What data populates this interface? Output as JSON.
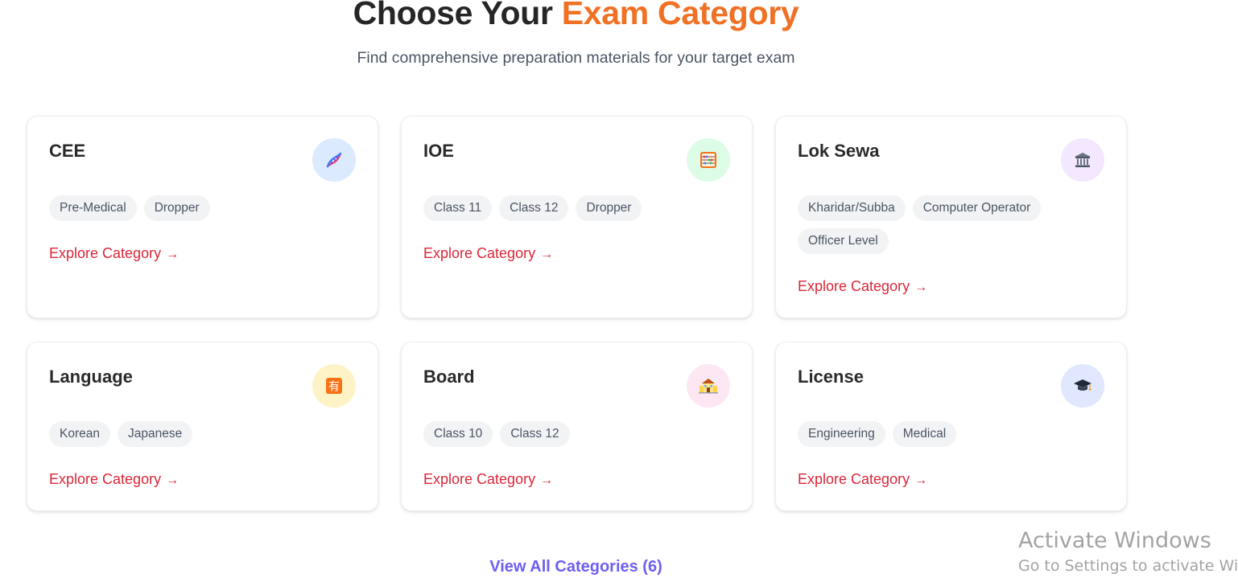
{
  "header": {
    "title_main": "Choose Your",
    "title_accent": "Exam Category",
    "subtitle": "Find comprehensive preparation materials for your target exam"
  },
  "colors": {
    "accent": "#f07124",
    "link": "#dc2638",
    "view_all": "#6d5ef0"
  },
  "categories": [
    {
      "title": "CEE",
      "icon": "dna-icon",
      "icon_bg": "#dbeafe",
      "tags": [
        "Pre-Medical",
        "Dropper"
      ],
      "cta": "Explore Category",
      "cta_arrow": "→"
    },
    {
      "title": "IOE",
      "icon": "abacus-icon",
      "icon_bg": "#dcfce7",
      "tags": [
        "Class 11",
        "Class 12",
        "Dropper"
      ],
      "cta": "Explore Category",
      "cta_arrow": "→"
    },
    {
      "title": "Lok Sewa",
      "icon": "government-building-icon",
      "icon_bg": "#f3e8ff",
      "tags": [
        "Kharidar/Subba",
        "Computer Operator",
        "Officer Level"
      ],
      "cta": "Explore Category",
      "cta_arrow": "→"
    },
    {
      "title": "Language",
      "icon": "japanese-character-icon",
      "icon_bg": "#fef3c7",
      "tags": [
        "Korean",
        "Japanese"
      ],
      "cta": "Explore Category",
      "cta_arrow": "→"
    },
    {
      "title": "Board",
      "icon": "school-building-icon",
      "icon_bg": "#fce7f3",
      "tags": [
        "Class 10",
        "Class 12"
      ],
      "cta": "Explore Category",
      "cta_arrow": "→"
    },
    {
      "title": "License",
      "icon": "graduation-cap-icon",
      "icon_bg": "#e0e7ff",
      "tags": [
        "Engineering",
        "Medical"
      ],
      "cta": "Explore Category",
      "cta_arrow": "→"
    }
  ],
  "view_all": "View All Categories (6)",
  "os_watermark": {
    "line1": "Activate Windows",
    "line2": "Go to Settings to activate Windows."
  }
}
